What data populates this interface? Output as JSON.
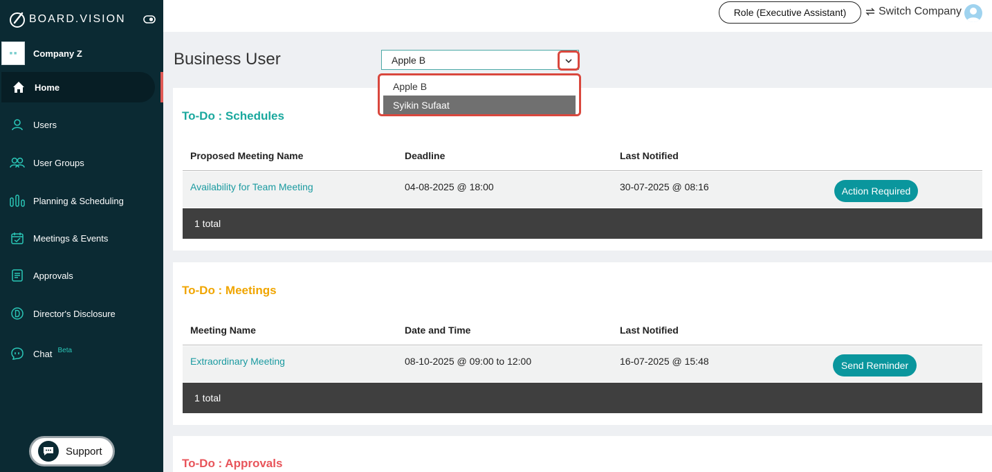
{
  "brand": {
    "name": "BOARD.VISION"
  },
  "company": {
    "name": "Company Z"
  },
  "sidebar": {
    "items": [
      {
        "label": "Home",
        "icon": "home-icon"
      },
      {
        "label": "Users",
        "icon": "user-icon"
      },
      {
        "label": "User Groups",
        "icon": "users-icon"
      },
      {
        "label": "Planning & Scheduling",
        "icon": "bars-icon"
      },
      {
        "label": "Meetings & Events",
        "icon": "calendar-icon"
      },
      {
        "label": "Approvals",
        "icon": "document-icon"
      },
      {
        "label": "Director's Disclosure",
        "icon": "d-circle-icon"
      },
      {
        "label": "Chat",
        "icon": "chat-icon",
        "badge": "Beta"
      }
    ],
    "support_label": "Support"
  },
  "header": {
    "role_label": "Role (Executive Assistant)",
    "switch_label": "Switch Company"
  },
  "page": {
    "title": "Business User",
    "user_select": {
      "value": "Apple B",
      "options": [
        "Apple B",
        "Syikin Sufaat"
      ],
      "highlighted": "Syikin Sufaat"
    }
  },
  "schedules": {
    "title": "To-Do : Schedules",
    "title_color": "#1aa89e",
    "headers": [
      "Proposed Meeting Name",
      "Deadline",
      "Last Notified"
    ],
    "rows": [
      {
        "name": "Availability for Team Meeting",
        "deadline": "04-08-2025 @ 18:00",
        "notified": "30-07-2025 @ 08:16",
        "action": "Action Required"
      }
    ],
    "total": "1 total"
  },
  "meetings": {
    "title": "To-Do : Meetings",
    "title_color": "#f0a500",
    "headers": [
      "Meeting Name",
      "Date and Time",
      "Last Notified"
    ],
    "rows": [
      {
        "name": "Extraordinary Meeting",
        "datetime": "08-10-2025 @ 09:00 to 12:00",
        "notified": "16-07-2025 @ 15:48",
        "action": "Send Reminder"
      }
    ],
    "total": "1 total"
  },
  "approvals": {
    "title": "To-Do : Approvals",
    "title_color": "#e8545a"
  },
  "colors": {
    "sidebar": "#0b2a33",
    "accent": "#0a969d",
    "highlight": "#d9473d"
  }
}
